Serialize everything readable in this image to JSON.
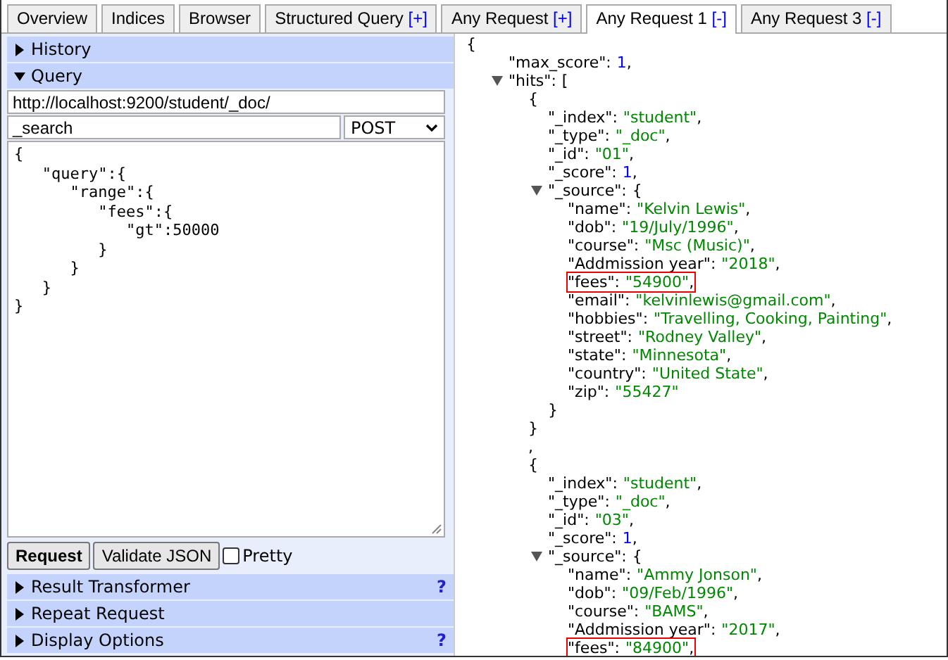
{
  "tabs": [
    {
      "label": "Overview",
      "selected": false
    },
    {
      "label": "Indices",
      "selected": false
    },
    {
      "label": "Browser",
      "selected": false
    },
    {
      "label": "Structured Query",
      "action": "[+]",
      "selected": false
    },
    {
      "label": "Any Request",
      "action": "[+]",
      "selected": false
    },
    {
      "label": "Any Request 1",
      "action": "[-]",
      "selected": true
    },
    {
      "label": "Any Request 3",
      "action": "[-]",
      "selected": false
    }
  ],
  "sections_top": [
    {
      "label": "History",
      "expanded": false
    },
    {
      "label": "Query",
      "expanded": true
    }
  ],
  "query": {
    "url": "http://localhost:9200/student/_doc/",
    "path": "_search",
    "method": "POST",
    "body": "{\n   \"query\":{\n      \"range\":{\n         \"fees\":{\n            \"gt\":50000\n         }\n      }\n   }\n}"
  },
  "buttons": [
    "Request",
    "Validate JSON"
  ],
  "pretty": {
    "label": "Pretty",
    "checked": false
  },
  "sections_bottom": [
    {
      "label": "Result Transformer",
      "expanded": false,
      "help": "?"
    },
    {
      "label": "Repeat Request",
      "expanded": false
    },
    {
      "label": "Display Options",
      "expanded": false,
      "help": "?"
    }
  ],
  "result": [
    {
      "value": "{",
      "kind": "bracket",
      "children": [
        {
          "key": "\"max_score\":",
          "value": "1",
          "kind": "number",
          "tail": ","
        },
        {
          "key": "\"hits\":",
          "value": "[",
          "kind": "bracket",
          "expanded": true,
          "children": [
            {
              "value": "{",
              "kind": "bracket",
              "close": "}",
              "children": [
                {
                  "key": "\"_index\":",
                  "value": "\"student\"",
                  "kind": "string",
                  "tail": ","
                },
                {
                  "key": "\"_type\":",
                  "value": "\"_doc\"",
                  "kind": "string",
                  "tail": ","
                },
                {
                  "key": "\"_id\":",
                  "value": "\"01\"",
                  "kind": "string",
                  "tail": ","
                },
                {
                  "key": "\"_score\":",
                  "value": "1",
                  "kind": "number",
                  "tail": ","
                },
                {
                  "key": "\"_source\":",
                  "value": "{",
                  "kind": "bracket",
                  "expanded": true,
                  "close": "}",
                  "children": [
                    {
                      "key": "\"name\":",
                      "value": "\"Kelvin Lewis\"",
                      "kind": "string",
                      "tail": ",",
                      "highlighted": false
                    },
                    {
                      "key": "\"dob\":",
                      "value": "\"19/July/1996\"",
                      "kind": "string",
                      "tail": ",",
                      "highlighted": false
                    },
                    {
                      "key": "\"course\":",
                      "value": "\"Msc (Music)\"",
                      "kind": "string",
                      "tail": ",",
                      "highlighted": false
                    },
                    {
                      "key": "\"Addmission year\":",
                      "value": "\"2018\"",
                      "kind": "string",
                      "tail": ",",
                      "highlighted": false
                    },
                    {
                      "key": "\"fees\":",
                      "value": "\"54900\"",
                      "kind": "string",
                      "tail": ",",
                      "highlighted": true
                    },
                    {
                      "key": "\"email\":",
                      "value": "\"kelvinlewis@gmail.com\"",
                      "kind": "string",
                      "tail": ",",
                      "highlighted": false
                    },
                    {
                      "key": "\"hobbies\":",
                      "value": "\"Travelling, Cooking, Painting\"",
                      "kind": "string",
                      "tail": ",",
                      "highlighted": false
                    },
                    {
                      "key": "\"street\":",
                      "value": "\"Rodney Valley\"",
                      "kind": "string",
                      "tail": ",",
                      "highlighted": false
                    },
                    {
                      "key": "\"state\":",
                      "value": "\"Minnesota\"",
                      "kind": "string",
                      "tail": ",",
                      "highlighted": false
                    },
                    {
                      "key": "\"country\":",
                      "value": "\"United State\"",
                      "kind": "string",
                      "tail": ",",
                      "highlighted": false
                    },
                    {
                      "key": "\"zip\":",
                      "value": "\"55427\"",
                      "kind": "string",
                      "highlighted": false
                    }
                  ]
                }
              ]
            },
            {
              "value": ",",
              "kind": "bracket"
            },
            {
              "value": "{",
              "kind": "bracket",
              "children": [
                {
                  "key": "\"_index\":",
                  "value": "\"student\"",
                  "kind": "string",
                  "tail": ","
                },
                {
                  "key": "\"_type\":",
                  "value": "\"_doc\"",
                  "kind": "string",
                  "tail": ","
                },
                {
                  "key": "\"_id\":",
                  "value": "\"03\"",
                  "kind": "string",
                  "tail": ","
                },
                {
                  "key": "\"_score\":",
                  "value": "1",
                  "kind": "number",
                  "tail": ","
                },
                {
                  "key": "\"_source\":",
                  "value": "{",
                  "kind": "bracket",
                  "expanded": true,
                  "children": [
                    {
                      "key": "\"name\":",
                      "value": "\"Ammy Jonson\"",
                      "kind": "string",
                      "tail": ",",
                      "highlighted": false
                    },
                    {
                      "key": "\"dob\":",
                      "value": "\"09/Feb/1996\"",
                      "kind": "string",
                      "tail": ",",
                      "highlighted": false
                    },
                    {
                      "key": "\"course\":",
                      "value": "\"BAMS\"",
                      "kind": "string",
                      "tail": ",",
                      "highlighted": false
                    },
                    {
                      "key": "\"Addmission year\":",
                      "value": "\"2017\"",
                      "kind": "string",
                      "tail": ",",
                      "highlighted": false
                    },
                    {
                      "key": "\"fees\":",
                      "value": "\"84900\"",
                      "kind": "string",
                      "tail": ",",
                      "highlighted": true
                    }
                  ]
                }
              ]
            }
          ]
        }
      ]
    }
  ]
}
